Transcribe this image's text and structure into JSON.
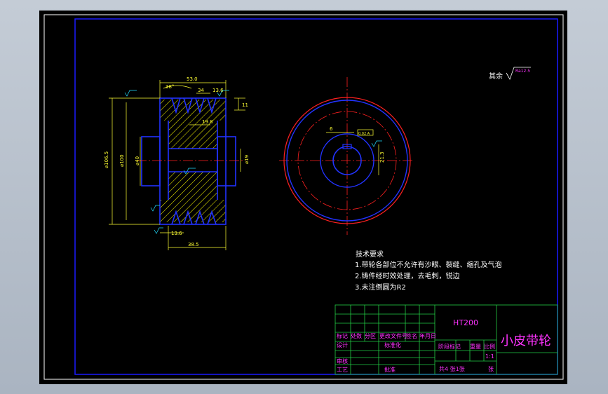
{
  "drawing": {
    "surface_roughness_note": "其余",
    "roughness_value": "Ra12.5",
    "colors": {
      "background": "#000000",
      "frame": "#1a1aff",
      "dimension": "#ffff33",
      "outline": "#2233ff",
      "hatch": "#ffff00",
      "centerline": "#ff2020",
      "text": "#ffffff",
      "title": "#ff33ff",
      "table": "#22cc44"
    }
  },
  "dimensions": {
    "top_width": "53.0",
    "bore_width": "34",
    "angle": "38°",
    "small_top": "13.6",
    "right_side": "11",
    "mid": "19.8",
    "outer_dia": "⌀106.5",
    "dia_100": "⌀100",
    "dia_40": "⌀40",
    "dia_19": "⌀19",
    "bottom_13": "13.6",
    "bottom_width": "38.5",
    "keyway": "6",
    "keyway_depth": "21.3",
    "tol_box": "0.02 A"
  },
  "notes": {
    "title": "技术要求",
    "items": [
      "1.带轮各部位不允许有沙眼、裂缝、缩孔及气泡",
      "2.铸件经时效处理，去毛刺，锐边",
      "3.未注倒圆为R2"
    ]
  },
  "title_block": {
    "material": "HT200",
    "part_name": "小皮带轮",
    "row_labels": [
      "标记",
      "处数",
      "分区",
      "更改文件号",
      "签名",
      "年月日"
    ],
    "design": "设计",
    "standardize": "标准化",
    "review": "审核",
    "process": "工艺",
    "approve": "批准",
    "stage_mark": "阶段标记",
    "weight": "重量",
    "scale": "比例",
    "scale_value": "1:1",
    "sheets": "共4 张1张",
    "sheet_suffix": "张"
  }
}
